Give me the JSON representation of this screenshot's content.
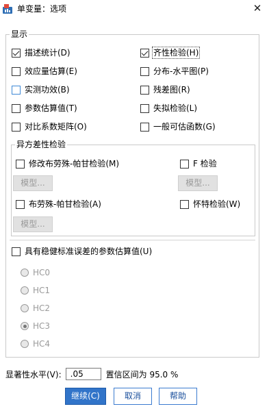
{
  "window": {
    "title": "单变量：选项",
    "close_glyph": "✕"
  },
  "display": {
    "legend": "显示",
    "left": [
      {
        "label": "描述统计(D)",
        "checked": true
      },
      {
        "label": "效应量估算(E)",
        "checked": false
      },
      {
        "label": "实测功效(B)",
        "checked": false,
        "focused": true
      },
      {
        "label": "参数估算值(T)",
        "checked": false
      },
      {
        "label": "对比系数矩阵(O)",
        "checked": false
      }
    ],
    "right": [
      {
        "label": "齐性检验(H)",
        "checked": true
      },
      {
        "label": "分布-水平图(P)",
        "checked": false
      },
      {
        "label": "残差图(R)",
        "checked": false
      },
      {
        "label": "失拟检验(L)",
        "checked": false
      },
      {
        "label": "一般可估函数(G)",
        "checked": false
      }
    ]
  },
  "hetero": {
    "legend": "异方差性检验",
    "modified_bp": {
      "label": "修改布劳殊-帕甘检验(M)",
      "checked": false
    },
    "f_test": {
      "label": "F 检验",
      "checked": false
    },
    "model_btn_1": "模型...",
    "model_btn_2": "模型...",
    "bp": {
      "label": "布劳殊-帕甘检验(A)",
      "checked": false
    },
    "white": {
      "label": "怀特检验(W)",
      "checked": false
    },
    "model_btn_3": "模型..."
  },
  "robust": {
    "label": "具有稳健标准误差的参数估算值(U)",
    "checked": false,
    "options": [
      {
        "label": "HC0",
        "checked": false
      },
      {
        "label": "HC1",
        "checked": false
      },
      {
        "label": "HC2",
        "checked": false
      },
      {
        "label": "HC3",
        "checked": true
      },
      {
        "label": "HC4",
        "checked": false
      }
    ]
  },
  "significance": {
    "label": "显著性水平(V):",
    "value": ".05",
    "ci_text": "置信区间为 95.0 %"
  },
  "buttons": {
    "continue": "继续(C)",
    "cancel": "取消",
    "help": "帮助"
  }
}
